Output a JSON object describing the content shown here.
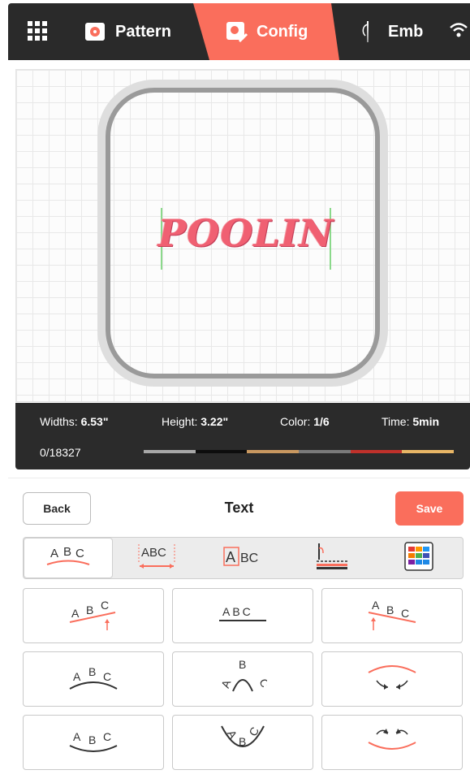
{
  "topbar": {
    "tabs": [
      {
        "label": "Pattern",
        "icon": "flower-photo-icon"
      },
      {
        "label": "Config",
        "icon": "config-edit-icon",
        "active": true
      },
      {
        "label": "Emb",
        "icon": "needle-icon"
      }
    ],
    "accent": "#fa6e5c"
  },
  "design": {
    "text": "POOLIN"
  },
  "info": {
    "widths_label": "Widths:",
    "widths_value": "6.53\"",
    "height_label": "Height:",
    "height_value": "3.22\"",
    "color_label": "Color:",
    "color_value": "1/6",
    "time_label": "Time:",
    "time_value": "5min",
    "stitches": "0/18327",
    "thread_colors": [
      "#a8a8a8",
      "#0d0d0d",
      "#c99860",
      "#7a7a7a",
      "#c0312b",
      "#e8b666"
    ]
  },
  "panel": {
    "back_label": "Back",
    "title": "Text",
    "save_label": "Save"
  },
  "tools": [
    {
      "name": "text-arc-tool",
      "icon": "arc-text-icon"
    },
    {
      "name": "text-spacing-tool",
      "icon": "text-spacing-icon"
    },
    {
      "name": "text-frame-tool",
      "icon": "letter-frame-icon"
    },
    {
      "name": "stitch-tool",
      "icon": "stitch-needle-icon"
    },
    {
      "name": "color-tool",
      "icon": "color-palette-icon"
    }
  ],
  "layouts": [
    {
      "name": "slant-up",
      "label": "A B C"
    },
    {
      "name": "straight",
      "label": "A B C"
    },
    {
      "name": "slant-down",
      "label": "A B C"
    },
    {
      "name": "arch-up",
      "label": "A B C"
    },
    {
      "name": "circle-top",
      "label": "A B C"
    },
    {
      "name": "bend-down",
      "label": ""
    },
    {
      "name": "arch-down",
      "label": "A B C"
    },
    {
      "name": "circle-bottom",
      "label": "A B C"
    },
    {
      "name": "bend-up",
      "label": ""
    }
  ]
}
